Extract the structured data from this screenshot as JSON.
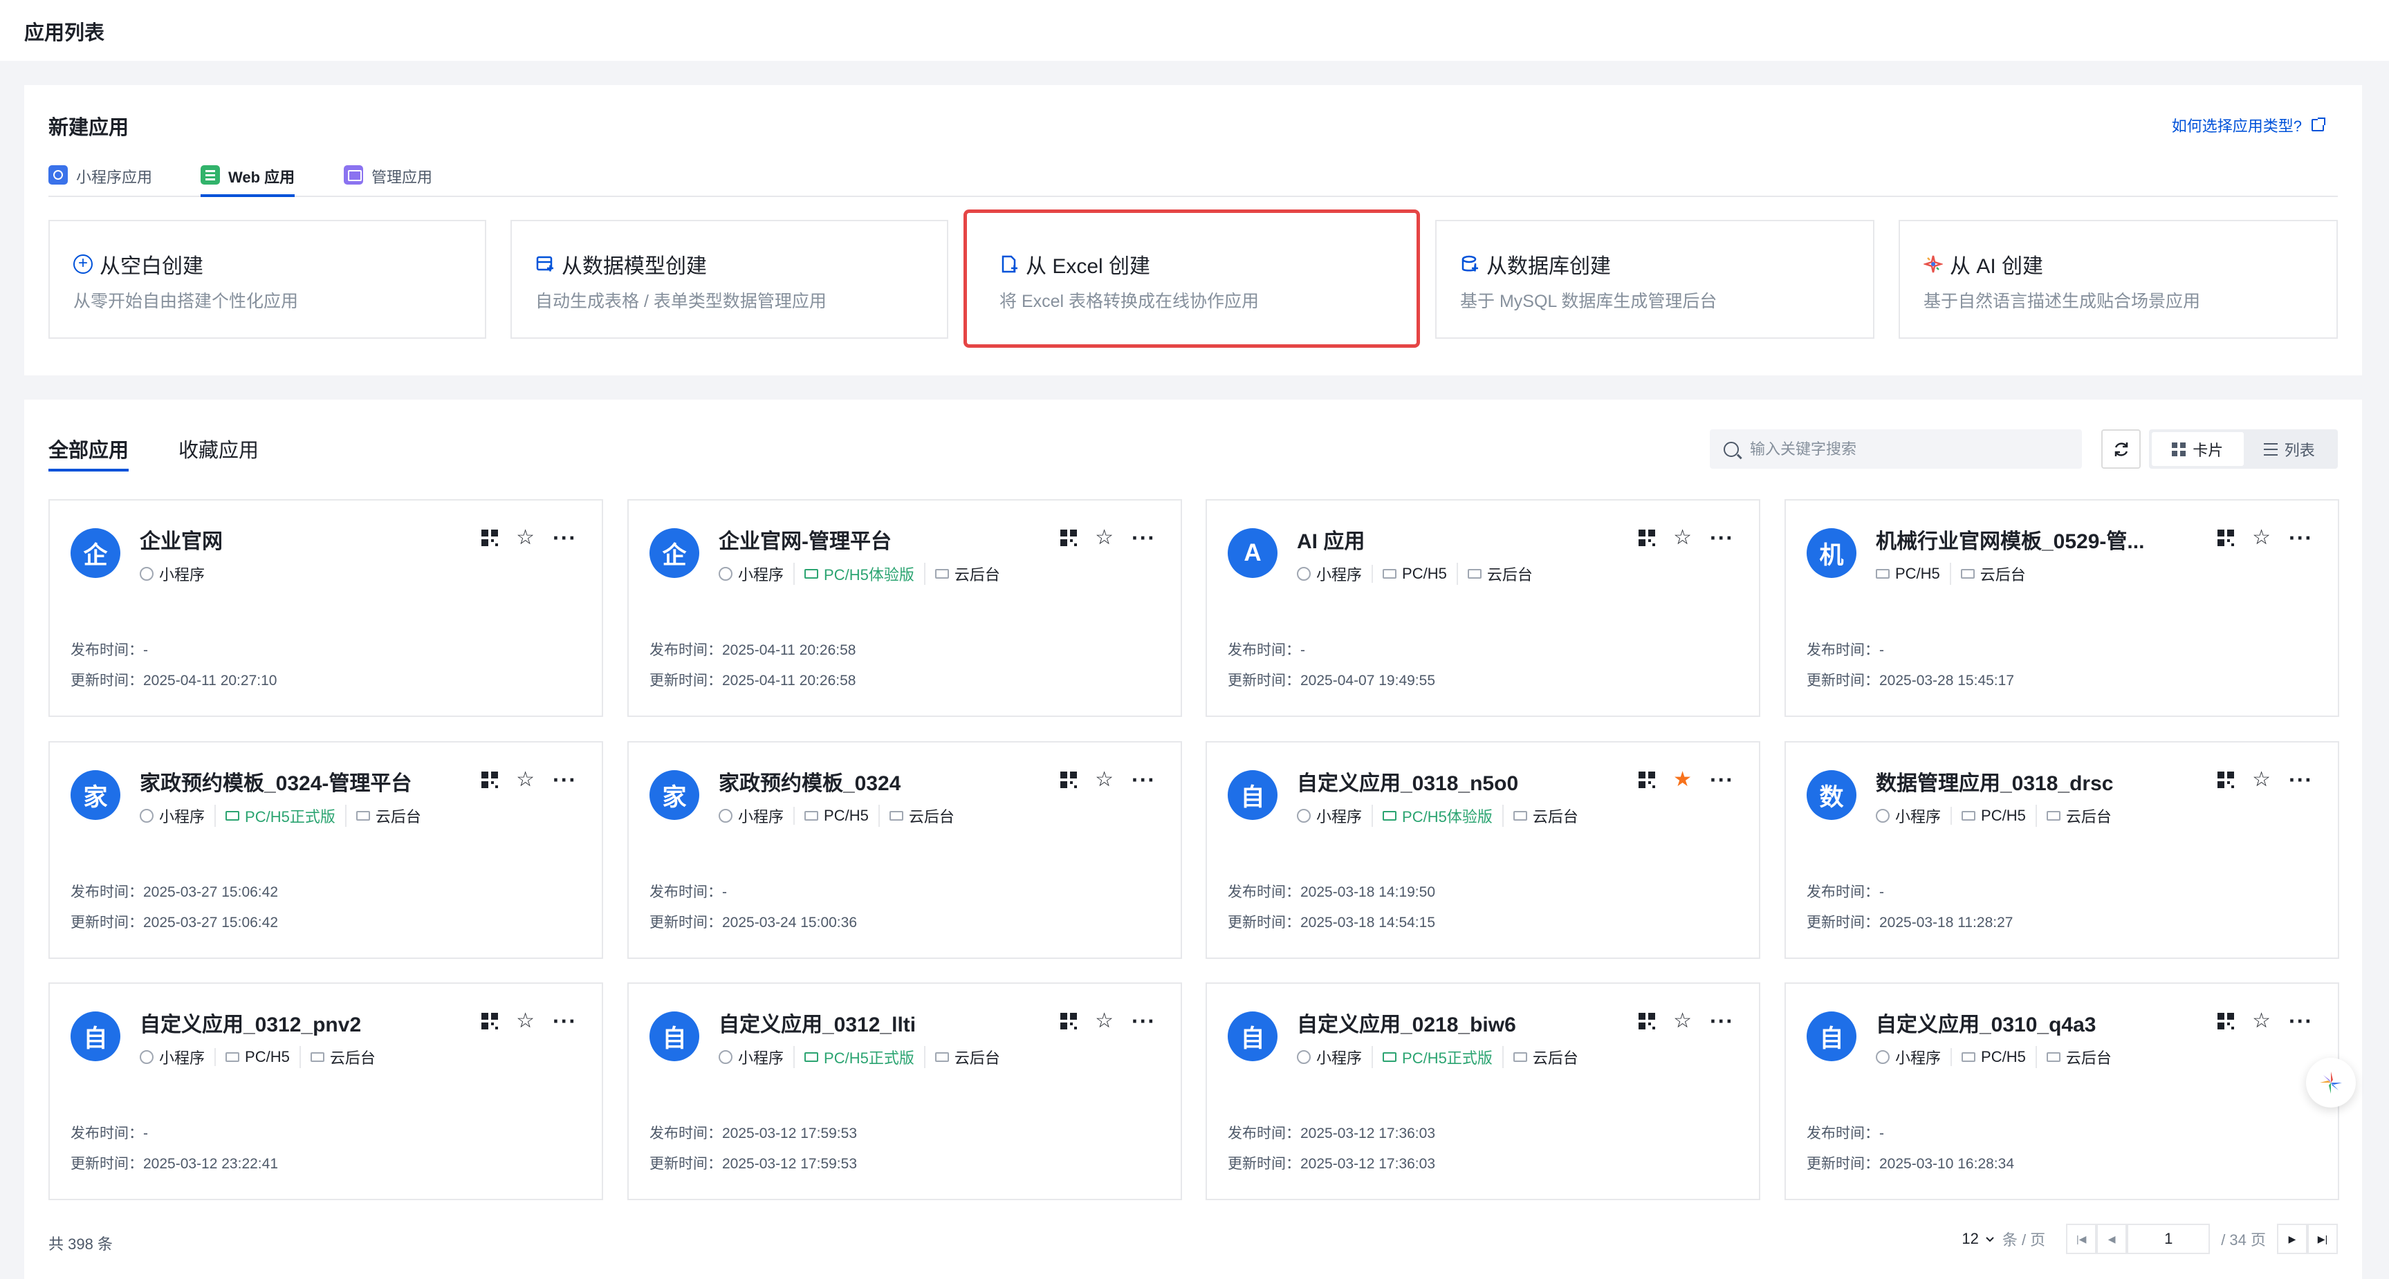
{
  "header": {
    "title": "应用列表"
  },
  "new_app": {
    "title": "新建应用",
    "help_link": "如何选择应用类型?",
    "tabs": [
      {
        "label": "小程序应用",
        "icon": "mini-program-icon"
      },
      {
        "label": "Web 应用",
        "icon": "web-icon",
        "active": true
      },
      {
        "label": "管理应用",
        "icon": "admin-icon"
      }
    ],
    "cards": [
      {
        "title": "从空白创建",
        "desc": "从零开始自由搭建个性化应用",
        "icon": "plus-circle-icon"
      },
      {
        "title": "从数据模型创建",
        "desc": "自动生成表格 / 表单类型数据管理应用",
        "icon": "data-model-icon"
      },
      {
        "title": "从 Excel 创建",
        "desc": "将 Excel 表格转换成在线协作应用",
        "icon": "excel-file-icon",
        "highlighted": true
      },
      {
        "title": "从数据库创建",
        "desc": "基于 MySQL 数据库生成管理后台",
        "icon": "database-icon"
      },
      {
        "title": "从 AI 创建",
        "desc": "基于自然语言描述生成贴合场景应用",
        "icon": "ai-sparkle-icon"
      }
    ]
  },
  "apps": {
    "tabs": [
      {
        "label": "全部应用",
        "active": true
      },
      {
        "label": "收藏应用"
      }
    ],
    "search_placeholder": "输入关键字搜索",
    "view_card": "卡片",
    "view_list": "列表",
    "pub_label": "发布时间：",
    "upd_label": "更新时间：",
    "items": [
      {
        "avatar": "企",
        "name": "企业官网",
        "tags": [
          {
            "t": "小程序",
            "k": "mp"
          }
        ],
        "published": "-",
        "updated": "2025-04-11 20:27:10",
        "starred": false
      },
      {
        "avatar": "企",
        "name": "企业官网-管理平台",
        "tags": [
          {
            "t": "小程序",
            "k": "mp"
          },
          {
            "t": "PC/H5体验版",
            "k": "pc",
            "green": true
          },
          {
            "t": "云后台",
            "k": "cloud"
          }
        ],
        "published": "2025-04-11 20:26:58",
        "updated": "2025-04-11 20:26:58",
        "starred": false
      },
      {
        "avatar": "A",
        "name": "AI 应用",
        "tags": [
          {
            "t": "小程序",
            "k": "mp"
          },
          {
            "t": "PC/H5",
            "k": "pc"
          },
          {
            "t": "云后台",
            "k": "cloud"
          }
        ],
        "published": "-",
        "updated": "2025-04-07 19:49:55",
        "starred": false
      },
      {
        "avatar": "机",
        "name": "机械行业官网模板_0529-管...",
        "tags": [
          {
            "t": "PC/H5",
            "k": "pc"
          },
          {
            "t": "云后台",
            "k": "cloud"
          }
        ],
        "published": "-",
        "updated": "2025-03-28 15:45:17",
        "starred": false
      },
      {
        "avatar": "家",
        "name": "家政预约模板_0324-管理平台",
        "tags": [
          {
            "t": "小程序",
            "k": "mp"
          },
          {
            "t": "PC/H5正式版",
            "k": "pc",
            "green": true
          },
          {
            "t": "云后台",
            "k": "cloud"
          }
        ],
        "published": "2025-03-27 15:06:42",
        "updated": "2025-03-27 15:06:42",
        "starred": false
      },
      {
        "avatar": "家",
        "name": "家政预约模板_0324",
        "tags": [
          {
            "t": "小程序",
            "k": "mp"
          },
          {
            "t": "PC/H5",
            "k": "pc"
          },
          {
            "t": "云后台",
            "k": "cloud"
          }
        ],
        "published": "-",
        "updated": "2025-03-24 15:00:36",
        "starred": false
      },
      {
        "avatar": "自",
        "name": "自定义应用_0318_n5o0",
        "tags": [
          {
            "t": "小程序",
            "k": "mp"
          },
          {
            "t": "PC/H5体验版",
            "k": "pc",
            "green": true
          },
          {
            "t": "云后台",
            "k": "cloud"
          }
        ],
        "published": "2025-03-18 14:19:50",
        "updated": "2025-03-18 14:54:15",
        "starred": true
      },
      {
        "avatar": "数",
        "name": "数据管理应用_0318_drsc",
        "tags": [
          {
            "t": "小程序",
            "k": "mp"
          },
          {
            "t": "PC/H5",
            "k": "pc"
          },
          {
            "t": "云后台",
            "k": "cloud"
          }
        ],
        "published": "-",
        "updated": "2025-03-18 11:28:27",
        "starred": false
      },
      {
        "avatar": "自",
        "name": "自定义应用_0312_pnv2",
        "tags": [
          {
            "t": "小程序",
            "k": "mp"
          },
          {
            "t": "PC/H5",
            "k": "pc"
          },
          {
            "t": "云后台",
            "k": "cloud"
          }
        ],
        "published": "-",
        "updated": "2025-03-12 23:22:41",
        "starred": false
      },
      {
        "avatar": "自",
        "name": "自定义应用_0312_llti",
        "tags": [
          {
            "t": "小程序",
            "k": "mp"
          },
          {
            "t": "PC/H5正式版",
            "k": "pc",
            "green": true
          },
          {
            "t": "云后台",
            "k": "cloud"
          }
        ],
        "published": "2025-03-12 17:59:53",
        "updated": "2025-03-12 17:59:53",
        "starred": false
      },
      {
        "avatar": "自",
        "name": "自定义应用_0218_biw6",
        "tags": [
          {
            "t": "小程序",
            "k": "mp"
          },
          {
            "t": "PC/H5正式版",
            "k": "pc",
            "green": true
          },
          {
            "t": "云后台",
            "k": "cloud"
          }
        ],
        "published": "2025-03-12 17:36:03",
        "updated": "2025-03-12 17:36:03",
        "starred": false
      },
      {
        "avatar": "自",
        "name": "自定义应用_0310_q4a3",
        "tags": [
          {
            "t": "小程序",
            "k": "mp"
          },
          {
            "t": "PC/H5",
            "k": "pc"
          },
          {
            "t": "云后台",
            "k": "cloud"
          }
        ],
        "published": "-",
        "updated": "2025-03-10 16:28:34",
        "starred": false
      }
    ]
  },
  "pagination": {
    "total_text": "共 398 条",
    "page_size": "12",
    "per_page_unit": "条 / 页",
    "current_page": "1",
    "total_pages_text": "/ 34 页"
  },
  "colors": {
    "accent": "#0052d9",
    "avatar": "#1e6fe8",
    "green": "#2ba471",
    "star_on": "#f7721c",
    "highlight": "#e54545"
  }
}
